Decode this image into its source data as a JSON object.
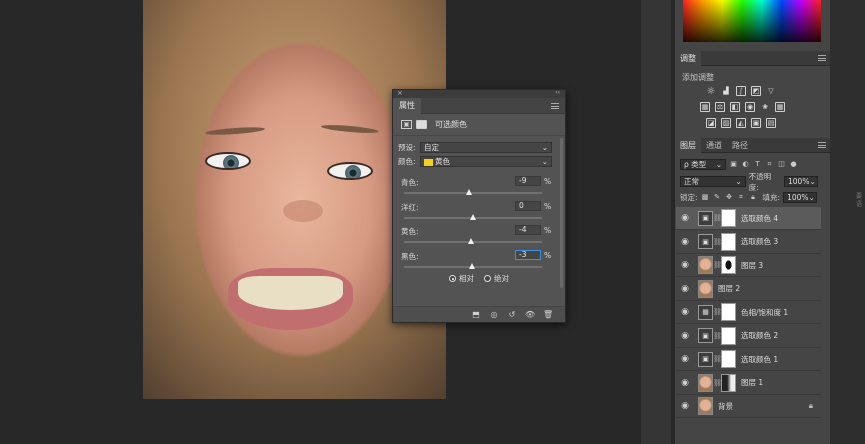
{
  "properties_panel": {
    "tab_label": "属性",
    "adjustment_title": "可选颜色",
    "preset_label": "预设:",
    "preset_value": "自定",
    "color_label": "颜色:",
    "color_value": "黄色",
    "color_swatch": "#f2d21a",
    "sliders": [
      {
        "label": "青色:",
        "value": "-9",
        "unit": "%",
        "position": 0.47
      },
      {
        "label": "洋红:",
        "value": "0",
        "unit": "%",
        "position": 0.5
      },
      {
        "label": "黄色:",
        "value": "-4",
        "unit": "%",
        "position": 0.485
      },
      {
        "label": "黑色:",
        "value": "-3",
        "unit": "%",
        "position": 0.49
      }
    ],
    "method_relative": "相对",
    "method_absolute": "绝对",
    "method_selected": "relative"
  },
  "adjustments_panel": {
    "tab_label": "调整",
    "add_label": "添加调整"
  },
  "layers_panel": {
    "tabs": [
      "图层",
      "通道",
      "路径"
    ],
    "kind_filter": "ρ 类型",
    "blend_mode": "正常",
    "opacity_label": "不透明度:",
    "opacity_value": "100%",
    "lock_label": "锁定:",
    "fill_label": "填充:",
    "fill_value": "100%",
    "layers": [
      {
        "name": "选取颜色 4",
        "kind": "adjustment",
        "mask": "white",
        "selected": true
      },
      {
        "name": "选取颜色 3",
        "kind": "adjustment",
        "mask": "white",
        "selected": false
      },
      {
        "name": "图层 3",
        "kind": "pixel-mask",
        "mask": "dark",
        "selected": false
      },
      {
        "name": "图层 2",
        "kind": "pixel",
        "mask": "none",
        "selected": false
      },
      {
        "name": "色相/饱和度 1",
        "kind": "adjustment",
        "mask": "white",
        "selected": false
      },
      {
        "name": "选取颜色 2",
        "kind": "adjustment",
        "mask": "white",
        "selected": false
      },
      {
        "name": "选取颜色 1",
        "kind": "adjustment",
        "mask": "white",
        "selected": false
      },
      {
        "name": "图层 1",
        "kind": "pixel-mask",
        "mask": "half",
        "selected": false
      },
      {
        "name": "背景",
        "kind": "background",
        "mask": "none",
        "selected": false
      }
    ]
  },
  "side_text": "要\n语"
}
